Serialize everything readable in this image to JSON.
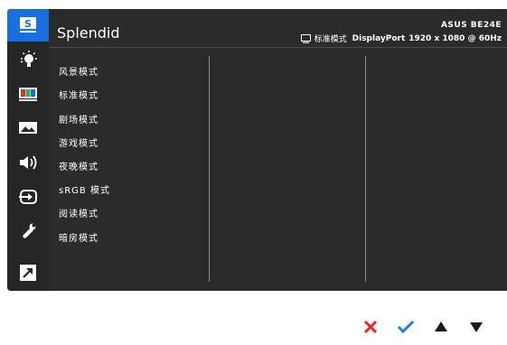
{
  "app": {
    "title": "Splendid",
    "model": "ASUS BE24E",
    "status": {
      "mode": "标准模式",
      "input": "DisplayPort",
      "resolution": "1920 x 1080 @ 60Hz"
    }
  },
  "sidebar": {
    "items": [
      {
        "icon": "splendid-s-icon",
        "label": "S",
        "active": true
      },
      {
        "icon": "blue-light-filter-icon",
        "active": false
      },
      {
        "icon": "color-bars-icon",
        "active": false
      },
      {
        "icon": "image-icon",
        "active": false
      },
      {
        "icon": "speaker-icon",
        "active": false
      },
      {
        "icon": "input-select-icon",
        "active": false
      },
      {
        "icon": "wrench-icon",
        "active": false
      },
      {
        "icon": "shortcut-arrow-icon",
        "active": false
      }
    ]
  },
  "menu": {
    "items": [
      "风景模式",
      "标准模式",
      "剧场模式",
      "游戏模式",
      "夜晚模式",
      "sRGB 模式",
      "阅读模式",
      "暗房模式"
    ]
  },
  "controls": [
    {
      "name": "close-icon",
      "color": "#e8262c"
    },
    {
      "name": "check-icon",
      "color": "#1a7fe0"
    },
    {
      "name": "up-arrow-icon",
      "color": "#1a1a1a"
    },
    {
      "name": "down-arrow-icon",
      "color": "#1a1a1a"
    }
  ],
  "colors": {
    "accent": "#1a6fe0",
    "panel": "#2b2b2b",
    "close": "#e8262c",
    "confirm": "#1a7fe0"
  }
}
